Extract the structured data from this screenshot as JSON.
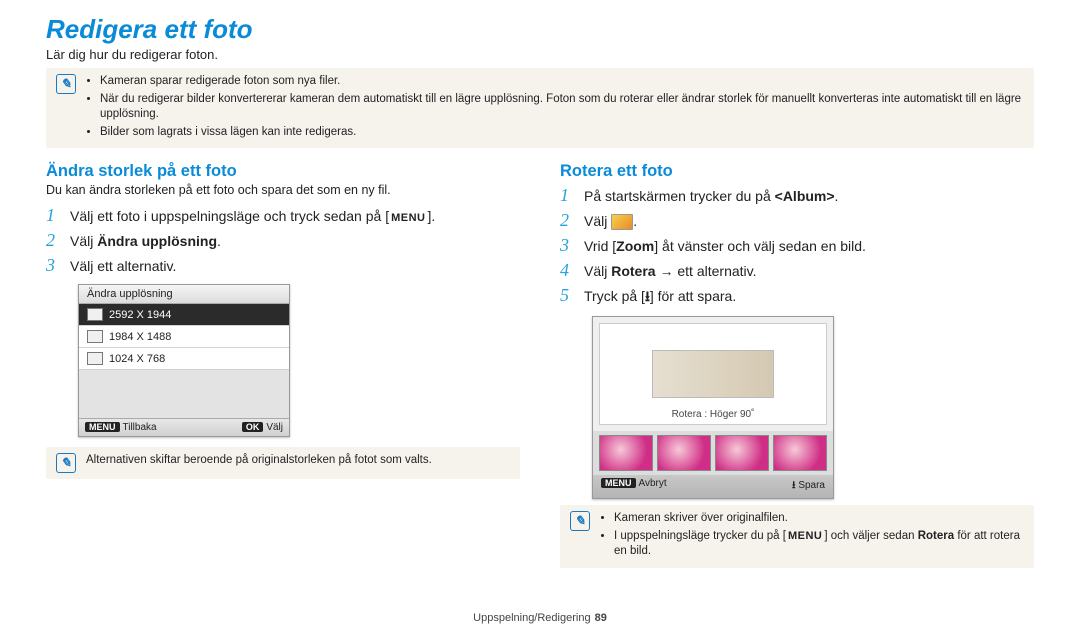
{
  "title": "Redigera ett foto",
  "intro": "Lär dig hur du redigerar foton.",
  "top_note": [
    "Kameran sparar redigerade foton som nya filer.",
    "När du redigerar bilder konvertererar kameran dem automatiskt till en lägre upplösning. Foton som du roterar eller ändrar storlek för manuellt konverteras inte automatiskt till en lägre upplösning.",
    "Bilder som lagrats i vissa lägen kan inte redigeras."
  ],
  "left": {
    "heading": "Ändra storlek på ett foto",
    "sub": "Du kan ändra storleken på ett foto och spara det som en ny fil.",
    "steps": [
      {
        "n": "1",
        "pre": "Välj ett foto i uppspelningsläge och tryck sedan på [",
        "btn": "MENU",
        "post": "]."
      },
      {
        "n": "2",
        "pre": "Välj ",
        "bold": "Ändra upplösning",
        "post": "."
      },
      {
        "n": "3",
        "pre": "Välj ett alternativ.",
        "post": ""
      }
    ],
    "menu": {
      "header": "Ändra upplösning",
      "items": [
        "2592 X 1944",
        "1984 X 1488",
        "1024 X 768"
      ],
      "footer_left_btn": "MENU",
      "footer_left": "Tillbaka",
      "footer_right_btn": "OK",
      "footer_right": "Välj"
    },
    "bottom_note": "Alternativen skiftar beroende på originalstorleken på fotot som valts."
  },
  "right": {
    "heading": "Rotera ett foto",
    "steps": [
      {
        "n": "1",
        "html": "På startskärmen trycker du på <b>&lt;Album&gt;</b>."
      },
      {
        "n": "2",
        "html": "Välj "
      },
      {
        "n": "3",
        "html": "Vrid [<b>Zoom</b>] åt vänster och välj sedan en bild."
      },
      {
        "n": "4",
        "html": "Välj <b>Rotera</b> → ett alternativ."
      },
      {
        "n": "5",
        "html": "Tryck på [ ] för att spara."
      }
    ],
    "preview": {
      "rot_label": "Rotera : Höger 90˚",
      "footer_left_btn": "MENU",
      "footer_left": "Avbryt",
      "footer_right": "Spara"
    },
    "bottom_note": [
      "Kameran skriver över originalfilen.",
      "I uppspelningsläge trycker du på [MENU] och väljer sedan Rotera för att rotera en bild."
    ]
  },
  "footer": {
    "section": "Uppspelning/Redigering",
    "page": "89"
  },
  "chart_data": {
    "type": "table",
    "title": "Ändra upplösning – alternativ",
    "columns": [
      "Upplösning"
    ],
    "rows": [
      [
        "2592 X 1944"
      ],
      [
        "1984 X 1488"
      ],
      [
        "1024 X 768"
      ]
    ]
  }
}
